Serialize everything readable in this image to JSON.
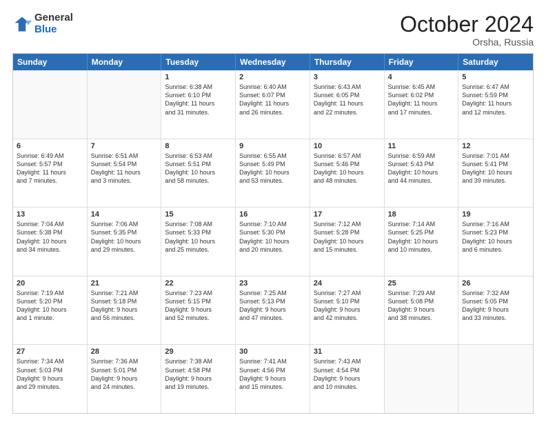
{
  "logo": {
    "general": "General",
    "blue": "Blue"
  },
  "title": "October 2024",
  "subtitle": "Orsha, Russia",
  "header_days": [
    "Sunday",
    "Monday",
    "Tuesday",
    "Wednesday",
    "Thursday",
    "Friday",
    "Saturday"
  ],
  "rows": [
    [
      {
        "day": "",
        "lines": [],
        "empty": true
      },
      {
        "day": "",
        "lines": [],
        "empty": true
      },
      {
        "day": "1",
        "lines": [
          "Sunrise: 6:38 AM",
          "Sunset: 6:10 PM",
          "Daylight: 11 hours",
          "and 31 minutes."
        ]
      },
      {
        "day": "2",
        "lines": [
          "Sunrise: 6:40 AM",
          "Sunset: 6:07 PM",
          "Daylight: 11 hours",
          "and 26 minutes."
        ]
      },
      {
        "day": "3",
        "lines": [
          "Sunrise: 6:43 AM",
          "Sunset: 6:05 PM",
          "Daylight: 11 hours",
          "and 22 minutes."
        ]
      },
      {
        "day": "4",
        "lines": [
          "Sunrise: 6:45 AM",
          "Sunset: 6:02 PM",
          "Daylight: 11 hours",
          "and 17 minutes."
        ]
      },
      {
        "day": "5",
        "lines": [
          "Sunrise: 6:47 AM",
          "Sunset: 5:59 PM",
          "Daylight: 11 hours",
          "and 12 minutes."
        ]
      }
    ],
    [
      {
        "day": "6",
        "lines": [
          "Sunrise: 6:49 AM",
          "Sunset: 5:57 PM",
          "Daylight: 11 hours",
          "and 7 minutes."
        ]
      },
      {
        "day": "7",
        "lines": [
          "Sunrise: 6:51 AM",
          "Sunset: 5:54 PM",
          "Daylight: 11 hours",
          "and 3 minutes."
        ]
      },
      {
        "day": "8",
        "lines": [
          "Sunrise: 6:53 AM",
          "Sunset: 5:51 PM",
          "Daylight: 10 hours",
          "and 58 minutes."
        ]
      },
      {
        "day": "9",
        "lines": [
          "Sunrise: 6:55 AM",
          "Sunset: 5:49 PM",
          "Daylight: 10 hours",
          "and 53 minutes."
        ]
      },
      {
        "day": "10",
        "lines": [
          "Sunrise: 6:57 AM",
          "Sunset: 5:46 PM",
          "Daylight: 10 hours",
          "and 48 minutes."
        ]
      },
      {
        "day": "11",
        "lines": [
          "Sunrise: 6:59 AM",
          "Sunset: 5:43 PM",
          "Daylight: 10 hours",
          "and 44 minutes."
        ]
      },
      {
        "day": "12",
        "lines": [
          "Sunrise: 7:01 AM",
          "Sunset: 5:41 PM",
          "Daylight: 10 hours",
          "and 39 minutes."
        ]
      }
    ],
    [
      {
        "day": "13",
        "lines": [
          "Sunrise: 7:04 AM",
          "Sunset: 5:38 PM",
          "Daylight: 10 hours",
          "and 34 minutes."
        ]
      },
      {
        "day": "14",
        "lines": [
          "Sunrise: 7:06 AM",
          "Sunset: 5:35 PM",
          "Daylight: 10 hours",
          "and 29 minutes."
        ]
      },
      {
        "day": "15",
        "lines": [
          "Sunrise: 7:08 AM",
          "Sunset: 5:33 PM",
          "Daylight: 10 hours",
          "and 25 minutes."
        ]
      },
      {
        "day": "16",
        "lines": [
          "Sunrise: 7:10 AM",
          "Sunset: 5:30 PM",
          "Daylight: 10 hours",
          "and 20 minutes."
        ]
      },
      {
        "day": "17",
        "lines": [
          "Sunrise: 7:12 AM",
          "Sunset: 5:28 PM",
          "Daylight: 10 hours",
          "and 15 minutes."
        ]
      },
      {
        "day": "18",
        "lines": [
          "Sunrise: 7:14 AM",
          "Sunset: 5:25 PM",
          "Daylight: 10 hours",
          "and 10 minutes."
        ]
      },
      {
        "day": "19",
        "lines": [
          "Sunrise: 7:16 AM",
          "Sunset: 5:23 PM",
          "Daylight: 10 hours",
          "and 6 minutes."
        ]
      }
    ],
    [
      {
        "day": "20",
        "lines": [
          "Sunrise: 7:19 AM",
          "Sunset: 5:20 PM",
          "Daylight: 10 hours",
          "and 1 minute."
        ]
      },
      {
        "day": "21",
        "lines": [
          "Sunrise: 7:21 AM",
          "Sunset: 5:18 PM",
          "Daylight: 9 hours",
          "and 56 minutes."
        ]
      },
      {
        "day": "22",
        "lines": [
          "Sunrise: 7:23 AM",
          "Sunset: 5:15 PM",
          "Daylight: 9 hours",
          "and 52 minutes."
        ]
      },
      {
        "day": "23",
        "lines": [
          "Sunrise: 7:25 AM",
          "Sunset: 5:13 PM",
          "Daylight: 9 hours",
          "and 47 minutes."
        ]
      },
      {
        "day": "24",
        "lines": [
          "Sunrise: 7:27 AM",
          "Sunset: 5:10 PM",
          "Daylight: 9 hours",
          "and 42 minutes."
        ]
      },
      {
        "day": "25",
        "lines": [
          "Sunrise: 7:29 AM",
          "Sunset: 5:08 PM",
          "Daylight: 9 hours",
          "and 38 minutes."
        ]
      },
      {
        "day": "26",
        "lines": [
          "Sunrise: 7:32 AM",
          "Sunset: 5:05 PM",
          "Daylight: 9 hours",
          "and 33 minutes."
        ]
      }
    ],
    [
      {
        "day": "27",
        "lines": [
          "Sunrise: 7:34 AM",
          "Sunset: 5:03 PM",
          "Daylight: 9 hours",
          "and 29 minutes."
        ]
      },
      {
        "day": "28",
        "lines": [
          "Sunrise: 7:36 AM",
          "Sunset: 5:01 PM",
          "Daylight: 9 hours",
          "and 24 minutes."
        ]
      },
      {
        "day": "29",
        "lines": [
          "Sunrise: 7:38 AM",
          "Sunset: 4:58 PM",
          "Daylight: 9 hours",
          "and 19 minutes."
        ]
      },
      {
        "day": "30",
        "lines": [
          "Sunrise: 7:41 AM",
          "Sunset: 4:56 PM",
          "Daylight: 9 hours",
          "and 15 minutes."
        ]
      },
      {
        "day": "31",
        "lines": [
          "Sunrise: 7:43 AM",
          "Sunset: 4:54 PM",
          "Daylight: 9 hours",
          "and 10 minutes."
        ]
      },
      {
        "day": "",
        "lines": [],
        "empty": true
      },
      {
        "day": "",
        "lines": [],
        "empty": true
      }
    ]
  ]
}
